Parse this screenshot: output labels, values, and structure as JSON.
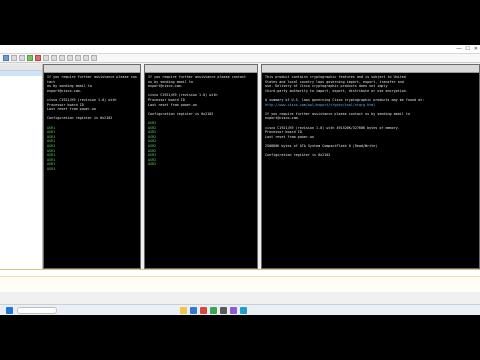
{
  "window": {
    "title": "",
    "controls": [
      "—",
      "☐",
      "✕"
    ]
  },
  "session_tree": {
    "header": "",
    "items": [
      "",
      "",
      "",
      "",
      ""
    ]
  },
  "terminals": [
    {
      "tab": "",
      "lines": [
        {
          "t": "If you require further assistance please contact",
          "c": ""
        },
        {
          "t": "us by sending email to",
          "c": ""
        },
        {
          "t": "export@cisco.com.",
          "c": ""
        },
        {
          "t": "",
          "c": ""
        },
        {
          "t": "cisco C1921/K9 (revision 1.0) with",
          "c": ""
        },
        {
          "t": "Processor board ID",
          "c": ""
        },
        {
          "t": "Last reset from power-on",
          "c": ""
        },
        {
          "t": "",
          "c": ""
        },
        {
          "t": "Configuration register is 0x2102",
          "c": ""
        },
        {
          "t": "",
          "c": ""
        },
        {
          "t": "ASR1",
          "c": "green"
        },
        {
          "t": "ASR1",
          "c": "green"
        },
        {
          "t": "ASR1",
          "c": "green"
        },
        {
          "t": "ASR1",
          "c": "green"
        },
        {
          "t": "ASR1",
          "c": "green"
        },
        {
          "t": "ASR1",
          "c": "green"
        },
        {
          "t": "ASR1",
          "c": "green"
        },
        {
          "t": "ASR1",
          "c": "green"
        },
        {
          "t": "ASR1",
          "c": "green"
        },
        {
          "t": "ASR1",
          "c": "green"
        }
      ]
    },
    {
      "tab": "",
      "lines": [
        {
          "t": "If you require further assistance please contact",
          "c": ""
        },
        {
          "t": "us by sending email to",
          "c": ""
        },
        {
          "t": "export@cisco.com.",
          "c": ""
        },
        {
          "t": "",
          "c": ""
        },
        {
          "t": "cisco C1921/K9 (revision 1.0) with",
          "c": ""
        },
        {
          "t": "Processor board ID",
          "c": ""
        },
        {
          "t": "Last reset from power-on",
          "c": ""
        },
        {
          "t": "",
          "c": ""
        },
        {
          "t": "Configuration register is 0x2102",
          "c": ""
        },
        {
          "t": "",
          "c": ""
        },
        {
          "t": "ASR2",
          "c": "green"
        },
        {
          "t": "ASR2",
          "c": "green"
        },
        {
          "t": "ASR2",
          "c": "green"
        },
        {
          "t": "ASR2",
          "c": "green"
        },
        {
          "t": "ASR2",
          "c": "green"
        },
        {
          "t": "ASR2",
          "c": "green"
        },
        {
          "t": "ASR2",
          "c": "green"
        },
        {
          "t": "ASR2",
          "c": "green"
        },
        {
          "t": "ASR2",
          "c": "green"
        },
        {
          "t": "ASR2",
          "c": "green"
        }
      ]
    },
    {
      "tab": "",
      "lines": [
        {
          "t": "This product contains cryptographic features and is subject to United",
          "c": ""
        },
        {
          "t": "States and local country laws governing import, export, transfer and",
          "c": ""
        },
        {
          "t": "use. Delivery of Cisco cryptographic products does not imply",
          "c": ""
        },
        {
          "t": "third-party authority to import, export, distribute or use encryption.",
          "c": ""
        },
        {
          "t": "",
          "c": ""
        },
        {
          "t": "A summary of U.S. laws governing Cisco cryptographic products may be found at:",
          "c": ""
        },
        {
          "t": "http://www.cisco.com/wwl/export/crypto/tool/stqrg.html",
          "c": "blue"
        },
        {
          "t": "",
          "c": ""
        },
        {
          "t": "If you require further assistance please contact us by sending email to",
          "c": ""
        },
        {
          "t": "export@cisco.com.",
          "c": ""
        },
        {
          "t": "",
          "c": ""
        },
        {
          "t": "cisco C1921/K9 (revision 1.0) with 491520K/32768K bytes of memory.",
          "c": ""
        },
        {
          "t": "Processor board ID",
          "c": ""
        },
        {
          "t": "Last reset from power-on",
          "c": ""
        },
        {
          "t": "",
          "c": ""
        },
        {
          "t": "250880K bytes of ATA System CompactFlash 0 (Read/Write)",
          "c": ""
        },
        {
          "t": "",
          "c": ""
        },
        {
          "t": "Configuration register is 0x2102",
          "c": ""
        },
        {
          "t": "",
          "c": ""
        }
      ]
    }
  ],
  "command_bar": {
    "label": "",
    "value": "",
    "placeholder": ""
  },
  "taskbar": {
    "search_placeholder": "",
    "time": "",
    "date": ""
  },
  "colors": {
    "terminal_bg": "#000000",
    "terminal_text": "#e8e8e8",
    "prompt_green": "#5fd35f",
    "link_blue": "#5fb8ff",
    "taskbar_bg": "#eaeef5"
  },
  "icons": [
    "toolbar-icons",
    "start-icon",
    "search-icon",
    "taskbar-app-icons",
    "tray-icons"
  ]
}
